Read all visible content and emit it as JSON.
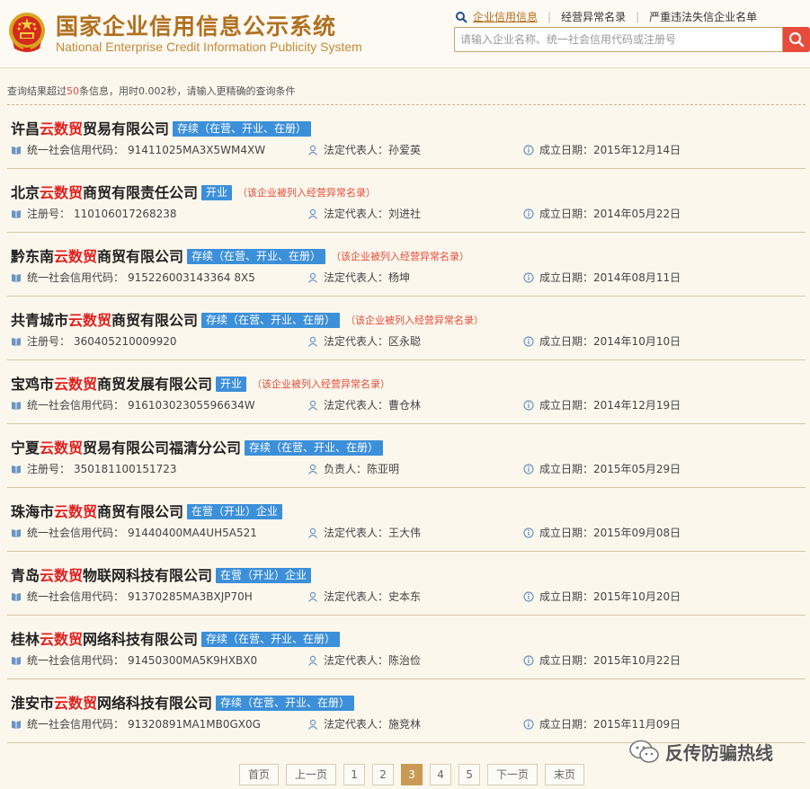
{
  "header": {
    "title_cn": "国家企业信用信息公示系统",
    "title_en": "National Enterprise Credit Information Publicity System",
    "nav": [
      {
        "label": "企业信用信息"
      },
      {
        "label": "经营异常名录"
      },
      {
        "label": "严重违法失信企业名单"
      }
    ],
    "search": {
      "placeholder": "请输入企业名称、统一社会信用代码或注册号",
      "value": ""
    }
  },
  "result_info": {
    "prefix": "查询结果超过",
    "count": "50",
    "suffix": "条信息，用时0.002秒，请输入更精确的查询条件"
  },
  "results": [
    {
      "name_pre": "许昌",
      "keyword": "云数贸",
      "name_post": "贸易有限公司",
      "status": "存续（在营、开业、在册）",
      "abnormal": "",
      "code_label": "统一社会信用代码：",
      "code": "91411025MA3X5WM4XW",
      "rep_label": "法定代表人：",
      "rep": "孙爱英",
      "date_label": "成立日期：",
      "date": "2015年12月14日"
    },
    {
      "name_pre": "北京",
      "keyword": "云数贸",
      "name_post": "商贸有限责任公司",
      "status": "开业",
      "abnormal": "（该企业被列入经营异常名录）",
      "code_label": "注册号：",
      "code": "110106017268238",
      "rep_label": "法定代表人：",
      "rep": "刘进社",
      "date_label": "成立日期：",
      "date": "2014年05月22日"
    },
    {
      "name_pre": "黔东南",
      "keyword": "云数贸",
      "name_post": "商贸有限公司",
      "status": "存续（在营、开业、在册）",
      "abnormal": "（该企业被列入经营异常名录）",
      "code_label": "统一社会信用代码：",
      "code": "915226003143364 8X5",
      "rep_label": "法定代表人：",
      "rep": "杨坤",
      "date_label": "成立日期：",
      "date": "2014年08月11日"
    },
    {
      "name_pre": "共青城市",
      "keyword": "云数贸",
      "name_post": "商贸有限公司",
      "status": "存续（在营、开业、在册）",
      "abnormal": "（该企业被列入经营异常名录）",
      "code_label": "注册号：",
      "code": "360405210009920",
      "rep_label": "法定代表人：",
      "rep": "区永聪",
      "date_label": "成立日期：",
      "date": "2014年10月10日"
    },
    {
      "name_pre": "宝鸡市",
      "keyword": "云数贸",
      "name_post": "商贸发展有限公司",
      "status": "开业",
      "abnormal": "（该企业被列入经营异常名录）",
      "code_label": "统一社会信用代码：",
      "code": "91610302305596634W",
      "rep_label": "法定代表人：",
      "rep": "曹仓林",
      "date_label": "成立日期：",
      "date": "2014年12月19日"
    },
    {
      "name_pre": "宁夏",
      "keyword": "云数贸",
      "name_post": "贸易有限公司福清分公司",
      "status": "存续（在营、开业、在册）",
      "abnormal": "",
      "code_label": "注册号：",
      "code": "350181100151723",
      "rep_label": "负责人：",
      "rep": "陈亚明",
      "date_label": "成立日期：",
      "date": "2015年05月29日"
    },
    {
      "name_pre": "珠海市",
      "keyword": "云数贸",
      "name_post": "商贸有限公司",
      "status": "在营（开业）企业",
      "abnormal": "",
      "code_label": "统一社会信用代码：",
      "code": "91440400MA4UH5A521",
      "rep_label": "法定代表人：",
      "rep": "王大伟",
      "date_label": "成立日期：",
      "date": "2015年09月08日"
    },
    {
      "name_pre": "青岛",
      "keyword": "云数贸",
      "name_post": "物联网科技有限公司",
      "status": "在营（开业）企业",
      "abnormal": "",
      "code_label": "统一社会信用代码：",
      "code": "91370285MA3BXJP70H",
      "rep_label": "法定代表人：",
      "rep": "史本东",
      "date_label": "成立日期：",
      "date": "2015年10月20日"
    },
    {
      "name_pre": "桂林",
      "keyword": "云数贸",
      "name_post": "网络科技有限公司",
      "status": "存续（在营、开业、在册）",
      "abnormal": "",
      "code_label": "统一社会信用代码：",
      "code": "91450300MA5K9HXBX0",
      "rep_label": "法定代表人：",
      "rep": "陈治俭",
      "date_label": "成立日期：",
      "date": "2015年10月22日"
    },
    {
      "name_pre": "淮安市",
      "keyword": "云数贸",
      "name_post": "网络科技有限公司",
      "status": "存续（在营、开业、在册）",
      "abnormal": "",
      "code_label": "统一社会信用代码：",
      "code": "91320891MA1MB0GX0G",
      "rep_label": "法定代表人：",
      "rep": "施竞林",
      "date_label": "成立日期：",
      "date": "2015年11月09日"
    }
  ],
  "pagination": {
    "first": "首页",
    "prev": "上一页",
    "pages": [
      "1",
      "2",
      "3",
      "4",
      "5"
    ],
    "current": "3",
    "next": "下一页",
    "last": "末页"
  },
  "watermark": {
    "text": "反传防骗热线",
    "icon": "wechat-icon"
  },
  "colors": {
    "accent": "#b1701f",
    "keyword": "#e02020",
    "badge": "#3c8fd9",
    "search_button": "#e84b3c",
    "current_page": "#c99a55",
    "background": "#fbf7ec"
  }
}
